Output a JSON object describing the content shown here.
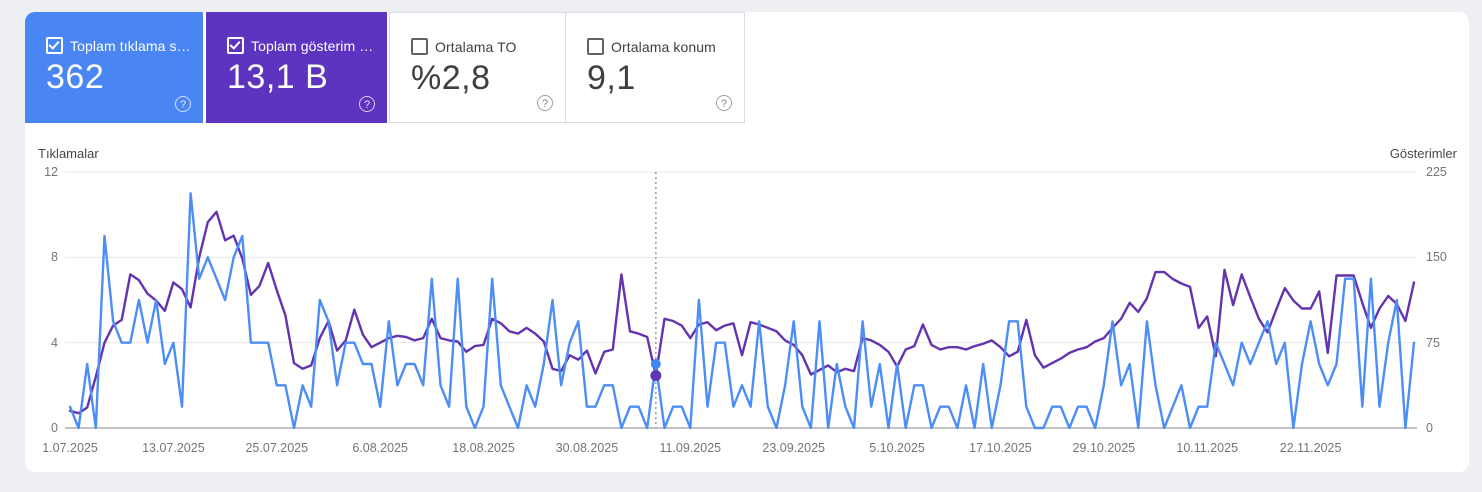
{
  "icons": {
    "help_glyph": "?"
  },
  "cards": [
    {
      "id": "clicks",
      "label": "Toplam tıklama s…",
      "value": "362",
      "checked": true,
      "background": "#4a85f4"
    },
    {
      "id": "impressions",
      "label": "Toplam gösterim …",
      "value": "13,1 B",
      "checked": true,
      "background": "#5c34c0"
    },
    {
      "id": "ctr",
      "label": "Ortalama TO",
      "value": "%2,8",
      "checked": false,
      "background": "#ffffff"
    },
    {
      "id": "position",
      "label": "Ortalama konum",
      "value": "9,1",
      "checked": false,
      "background": "#ffffff"
    }
  ],
  "chart_data": {
    "type": "line",
    "left_axis": {
      "title": "Tıklamalar",
      "ticks": [
        12,
        8,
        4,
        0
      ],
      "max": 12
    },
    "right_axis": {
      "title": "Gösterimler",
      "ticks": [
        225,
        150,
        75,
        0
      ],
      "max": 225
    },
    "x_ticks": {
      "labels": [
        "1.07.2025",
        "13.07.2025",
        "25.07.2025",
        "6.08.2025",
        "18.08.2025",
        "30.08.2025",
        "11.09.2025",
        "23.09.2025",
        "5.10.2025",
        "17.10.2025",
        "29.10.2025",
        "10.11.2025",
        "22.11.2025"
      ],
      "indices": [
        0,
        12,
        24,
        36,
        48,
        60,
        72,
        84,
        96,
        108,
        120,
        132,
        144
      ]
    },
    "series": [
      {
        "name": "Tıklamalar",
        "axis": "left",
        "color": "#4d8df6",
        "values": [
          1,
          0,
          3,
          0,
          9,
          5,
          4,
          4,
          6,
          4,
          6,
          3,
          4,
          1,
          11,
          7,
          8,
          7,
          6,
          8,
          9,
          4,
          4,
          4,
          2,
          2,
          0,
          2,
          1,
          6,
          5,
          2,
          4,
          4,
          3,
          3,
          1,
          5,
          2,
          3,
          3,
          2,
          7,
          2,
          1,
          7,
          1,
          0,
          1,
          7,
          2,
          1,
          0,
          2,
          1,
          3,
          6,
          2,
          4,
          5,
          1,
          1,
          2,
          2,
          0,
          1,
          1,
          0,
          3,
          0,
          1,
          1,
          0,
          6,
          1,
          4,
          4,
          1,
          2,
          1,
          5,
          1,
          0,
          2,
          5,
          1,
          0,
          5,
          0,
          3,
          1,
          0,
          5,
          1,
          3,
          0,
          3,
          0,
          2,
          2,
          0,
          1,
          1,
          0,
          2,
          0,
          3,
          0,
          2,
          5,
          5,
          1,
          0,
          0,
          1,
          1,
          0,
          1,
          1,
          0,
          2,
          5,
          2,
          3,
          0,
          5,
          2,
          0,
          1,
          2,
          0,
          1,
          1,
          4,
          3,
          2,
          4,
          3,
          4,
          5,
          3,
          4,
          0,
          3,
          5,
          3,
          2,
          3,
          7,
          7,
          1,
          7,
          1,
          4,
          6,
          0,
          4
        ]
      },
      {
        "name": "Gösterimler",
        "axis": "right",
        "color": "#6434af",
        "values": [
          15,
          13,
          18,
          45,
          75,
          90,
          95,
          135,
          130,
          118,
          112,
          103,
          128,
          122,
          106,
          150,
          181,
          190,
          165,
          169,
          149,
          117,
          125,
          145,
          121,
          99,
          57,
          52,
          55,
          79,
          94,
          68,
          77,
          104,
          82,
          71,
          75,
          79,
          81,
          80,
          77,
          79,
          96,
          79,
          77,
          76,
          67,
          72,
          73,
          96,
          92,
          85,
          83,
          88,
          83,
          76,
          52,
          50,
          64,
          60,
          68,
          48,
          67,
          69,
          135,
          85,
          83,
          80,
          46,
          96,
          94,
          90,
          79,
          91,
          93,
          86,
          90,
          92,
          64,
          93,
          91,
          88,
          85,
          77,
          73,
          64,
          47,
          51,
          55,
          49,
          52,
          50,
          79,
          77,
          73,
          67,
          54,
          69,
          72,
          91,
          73,
          69,
          71,
          71,
          69,
          72,
          74,
          77,
          71,
          63,
          67,
          95,
          64,
          53,
          57,
          61,
          66,
          69,
          71,
          76,
          79,
          88,
          96,
          110,
          102,
          114,
          137,
          137,
          131,
          127,
          124,
          88,
          98,
          63,
          139,
          108,
          135,
          115,
          96,
          84,
          104,
          123,
          112,
          105,
          105,
          120,
          66,
          134,
          134,
          134,
          110,
          88,
          105,
          116,
          109,
          94,
          128
        ]
      }
    ],
    "hover": {
      "index": 68,
      "clicks": 3,
      "impressions": 46
    },
    "grid": {
      "line_color": "#e8e8e8",
      "base_color": "#80868b",
      "hover_line_color": "#9aa0a6"
    }
  }
}
